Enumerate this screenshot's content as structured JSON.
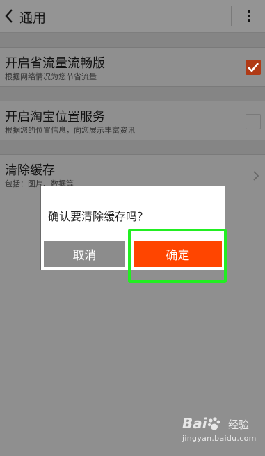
{
  "header": {
    "title": "通用",
    "back_icon": "chevron-left-icon",
    "menu_icon": "more-vertical-icon"
  },
  "settings": [
    {
      "label": "开启省流量流畅版",
      "sub": "根据网络情况为您节省流量",
      "control": "checkbox",
      "checked": true
    },
    {
      "label": "开启淘宝位置服务",
      "sub": "根据您的位置信息，向您展示丰富资讯",
      "control": "checkbox",
      "checked": false
    },
    {
      "label": "清除缓存",
      "sub": "包括：图片、数据等",
      "control": "chevron-right-icon"
    }
  ],
  "dialog": {
    "message": "确认要清除缓存吗？",
    "cancel_label": "取消",
    "confirm_label": "确定"
  },
  "watermark": {
    "brand_left": "Bai",
    "brand_right": "经验",
    "url": "jingyan.baidu.com"
  },
  "colors": {
    "confirm": "#ff4500",
    "checkbox_checked": "#b03a16",
    "highlight": "#22ee22"
  }
}
